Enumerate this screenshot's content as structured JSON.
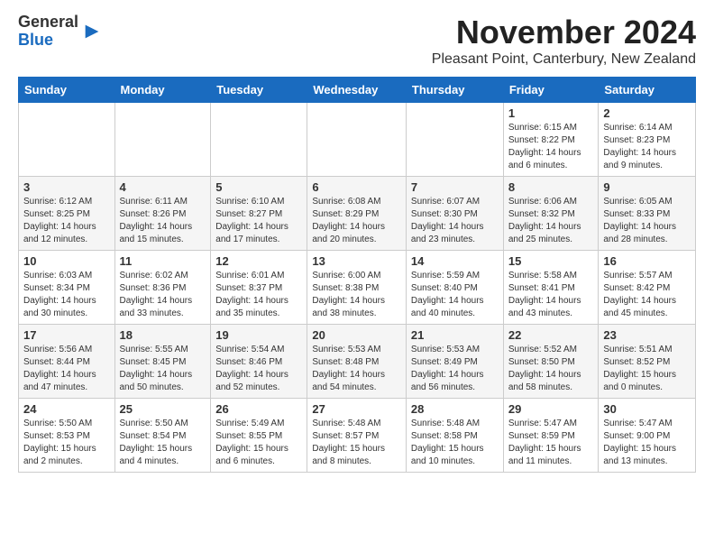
{
  "header": {
    "logo_general": "General",
    "logo_blue": "Blue",
    "month_title": "November 2024",
    "location": "Pleasant Point, Canterbury, New Zealand"
  },
  "days_of_week": [
    "Sunday",
    "Monday",
    "Tuesday",
    "Wednesday",
    "Thursday",
    "Friday",
    "Saturday"
  ],
  "weeks": [
    [
      {
        "day": "",
        "info": ""
      },
      {
        "day": "",
        "info": ""
      },
      {
        "day": "",
        "info": ""
      },
      {
        "day": "",
        "info": ""
      },
      {
        "day": "",
        "info": ""
      },
      {
        "day": "1",
        "info": "Sunrise: 6:15 AM\nSunset: 8:22 PM\nDaylight: 14 hours\nand 6 minutes."
      },
      {
        "day": "2",
        "info": "Sunrise: 6:14 AM\nSunset: 8:23 PM\nDaylight: 14 hours\nand 9 minutes."
      }
    ],
    [
      {
        "day": "3",
        "info": "Sunrise: 6:12 AM\nSunset: 8:25 PM\nDaylight: 14 hours\nand 12 minutes."
      },
      {
        "day": "4",
        "info": "Sunrise: 6:11 AM\nSunset: 8:26 PM\nDaylight: 14 hours\nand 15 minutes."
      },
      {
        "day": "5",
        "info": "Sunrise: 6:10 AM\nSunset: 8:27 PM\nDaylight: 14 hours\nand 17 minutes."
      },
      {
        "day": "6",
        "info": "Sunrise: 6:08 AM\nSunset: 8:29 PM\nDaylight: 14 hours\nand 20 minutes."
      },
      {
        "day": "7",
        "info": "Sunrise: 6:07 AM\nSunset: 8:30 PM\nDaylight: 14 hours\nand 23 minutes."
      },
      {
        "day": "8",
        "info": "Sunrise: 6:06 AM\nSunset: 8:32 PM\nDaylight: 14 hours\nand 25 minutes."
      },
      {
        "day": "9",
        "info": "Sunrise: 6:05 AM\nSunset: 8:33 PM\nDaylight: 14 hours\nand 28 minutes."
      }
    ],
    [
      {
        "day": "10",
        "info": "Sunrise: 6:03 AM\nSunset: 8:34 PM\nDaylight: 14 hours\nand 30 minutes."
      },
      {
        "day": "11",
        "info": "Sunrise: 6:02 AM\nSunset: 8:36 PM\nDaylight: 14 hours\nand 33 minutes."
      },
      {
        "day": "12",
        "info": "Sunrise: 6:01 AM\nSunset: 8:37 PM\nDaylight: 14 hours\nand 35 minutes."
      },
      {
        "day": "13",
        "info": "Sunrise: 6:00 AM\nSunset: 8:38 PM\nDaylight: 14 hours\nand 38 minutes."
      },
      {
        "day": "14",
        "info": "Sunrise: 5:59 AM\nSunset: 8:40 PM\nDaylight: 14 hours\nand 40 minutes."
      },
      {
        "day": "15",
        "info": "Sunrise: 5:58 AM\nSunset: 8:41 PM\nDaylight: 14 hours\nand 43 minutes."
      },
      {
        "day": "16",
        "info": "Sunrise: 5:57 AM\nSunset: 8:42 PM\nDaylight: 14 hours\nand 45 minutes."
      }
    ],
    [
      {
        "day": "17",
        "info": "Sunrise: 5:56 AM\nSunset: 8:44 PM\nDaylight: 14 hours\nand 47 minutes."
      },
      {
        "day": "18",
        "info": "Sunrise: 5:55 AM\nSunset: 8:45 PM\nDaylight: 14 hours\nand 50 minutes."
      },
      {
        "day": "19",
        "info": "Sunrise: 5:54 AM\nSunset: 8:46 PM\nDaylight: 14 hours\nand 52 minutes."
      },
      {
        "day": "20",
        "info": "Sunrise: 5:53 AM\nSunset: 8:48 PM\nDaylight: 14 hours\nand 54 minutes."
      },
      {
        "day": "21",
        "info": "Sunrise: 5:53 AM\nSunset: 8:49 PM\nDaylight: 14 hours\nand 56 minutes."
      },
      {
        "day": "22",
        "info": "Sunrise: 5:52 AM\nSunset: 8:50 PM\nDaylight: 14 hours\nand 58 minutes."
      },
      {
        "day": "23",
        "info": "Sunrise: 5:51 AM\nSunset: 8:52 PM\nDaylight: 15 hours\nand 0 minutes."
      }
    ],
    [
      {
        "day": "24",
        "info": "Sunrise: 5:50 AM\nSunset: 8:53 PM\nDaylight: 15 hours\nand 2 minutes."
      },
      {
        "day": "25",
        "info": "Sunrise: 5:50 AM\nSunset: 8:54 PM\nDaylight: 15 hours\nand 4 minutes."
      },
      {
        "day": "26",
        "info": "Sunrise: 5:49 AM\nSunset: 8:55 PM\nDaylight: 15 hours\nand 6 minutes."
      },
      {
        "day": "27",
        "info": "Sunrise: 5:48 AM\nSunset: 8:57 PM\nDaylight: 15 hours\nand 8 minutes."
      },
      {
        "day": "28",
        "info": "Sunrise: 5:48 AM\nSunset: 8:58 PM\nDaylight: 15 hours\nand 10 minutes."
      },
      {
        "day": "29",
        "info": "Sunrise: 5:47 AM\nSunset: 8:59 PM\nDaylight: 15 hours\nand 11 minutes."
      },
      {
        "day": "30",
        "info": "Sunrise: 5:47 AM\nSunset: 9:00 PM\nDaylight: 15 hours\nand 13 minutes."
      }
    ]
  ]
}
